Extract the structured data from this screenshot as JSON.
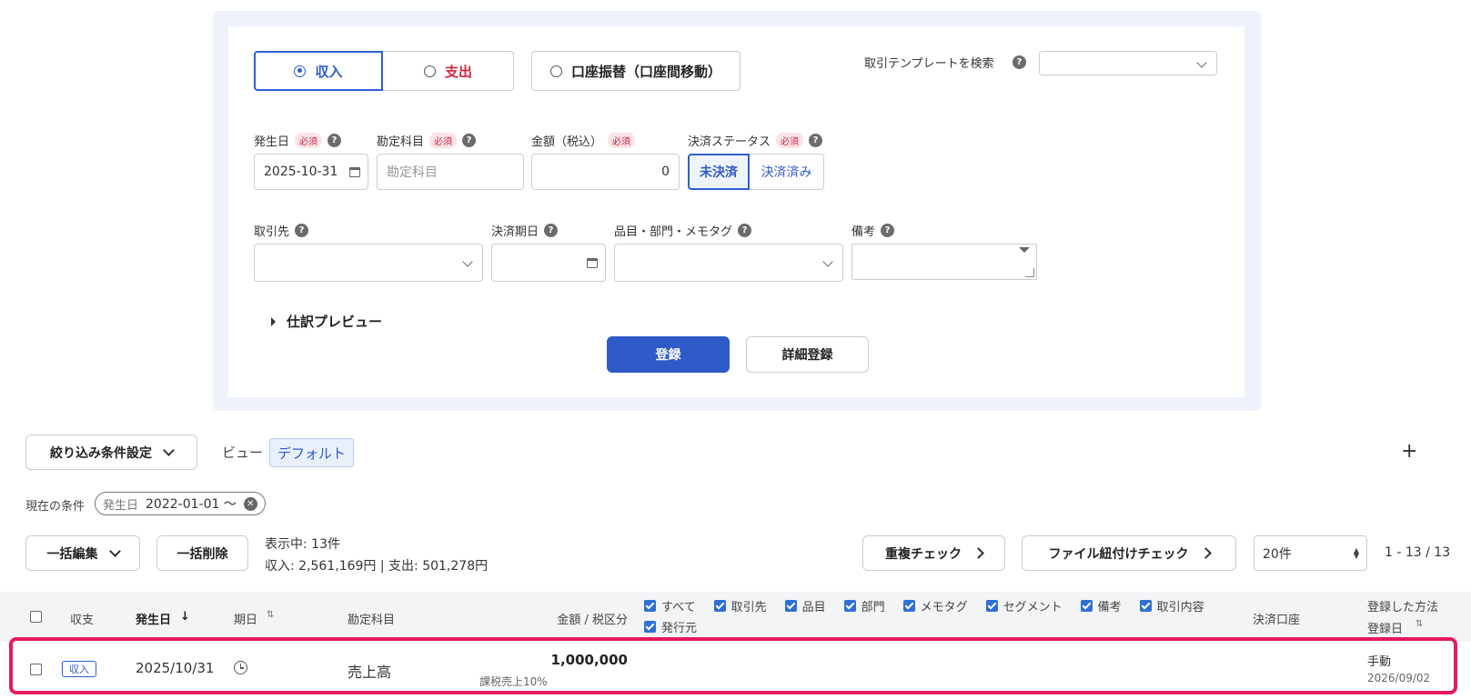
{
  "form": {
    "type_income": "収入",
    "type_expense": "支出",
    "type_transfer": "口座振替（口座間移動）",
    "template_search_label": "取引テンプレートを検索",
    "date_label": "発生日",
    "account_label": "勘定科目",
    "amount_label": "金額（税込）",
    "status_label": "決済ステータス",
    "required_badge": "必須",
    "help_glyph": "?",
    "date_value": "2025-10-31",
    "account_placeholder": "勘定科目",
    "amount_value": "0",
    "status_unsettled": "未決済",
    "status_settled": "決済済み",
    "partner_label": "取引先",
    "due_label": "決済期日",
    "item_label": "品目・部門・メモタグ",
    "note_label": "備考",
    "preview_label": "仕訳プレビュー",
    "register_button": "登録",
    "detail_register_button": "詳細登録"
  },
  "filter": {
    "settings_button": "絞り込み条件設定",
    "view_label": "ビュー",
    "view_value": "デフォルト",
    "add_glyph": "+",
    "current_label": "現在の条件",
    "chip_key": "発生日",
    "chip_value": "2022-01-01 〜"
  },
  "toolbar": {
    "bulk_edit": "一括編集",
    "bulk_delete": "一括削除",
    "showing": "表示中: 13件",
    "totals": "収入: 2,561,169円 | 支出: 501,278円",
    "duplicate_check": "重複チェック",
    "file_check": "ファイル紐付けチェック",
    "per_page": "20件",
    "pagination": "1 - 13 / 13"
  },
  "table": {
    "headers": {
      "type": "収支",
      "date": "発生日",
      "due": "期日",
      "account": "勘定科目",
      "amount": "金額 / 税区分",
      "wallet": "決済口座",
      "method": "登録した方法",
      "registered": "登録日"
    },
    "column_options": [
      "すべて",
      "取引先",
      "品目",
      "部門",
      "メモタグ",
      "セグメント",
      "備考",
      "取引内容",
      "発行元"
    ],
    "rows": [
      {
        "type": "収入",
        "date": "2025/10/31",
        "account": "売上高",
        "amount": "1,000,000",
        "tax": "課税売上10%",
        "method": "手動",
        "registered": "2026/09/02"
      }
    ]
  },
  "colors": {
    "accent": "#2f5bc9",
    "income": "#2f5fd0",
    "expense": "#d0263a",
    "highlight": "#e8185e"
  }
}
